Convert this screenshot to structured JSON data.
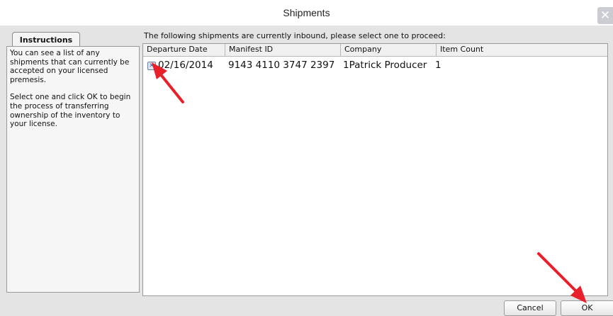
{
  "window": {
    "title": "Shipments"
  },
  "instructions": {
    "tab_label": "Instructions",
    "paragraph1": "You can see a list of any shipments that can currently be accepted on your licensed premesis.",
    "paragraph2": "Select one and click OK to begin the process of transferring ownership of the inventory to your license."
  },
  "shipments": {
    "prompt": "The following shipments are currently inbound, please select one to proceed:",
    "columns": [
      "Departure Date",
      "Manifest ID",
      "Company",
      "Item Count"
    ],
    "rows": [
      {
        "departure_date": "02/16/2014",
        "manifest_id": "9143 4110 3747 2397",
        "company": "1Patrick Producer",
        "item_count": "1"
      }
    ]
  },
  "buttons": {
    "cancel_label": "Cancel",
    "ok_label": "OK"
  },
  "colors": {
    "annotation_arrow": "#e8202a"
  }
}
